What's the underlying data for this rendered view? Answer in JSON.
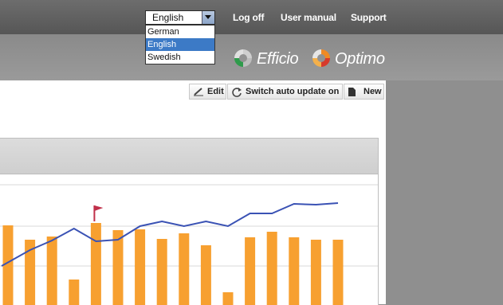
{
  "topnav": {
    "language_selected": "English",
    "logoff": "Log off",
    "manual": "User manual",
    "support": "Support"
  },
  "language_menu": {
    "options": [
      "German",
      "English",
      "Swedish"
    ],
    "highlighted_index": 1
  },
  "brand": {
    "product1": "Efficio",
    "product2": "Optimo",
    "colors": {
      "green": "#2e9b4b",
      "orange": "#f08a24",
      "red": "#d63a2b"
    }
  },
  "toolbar": {
    "edit": "Edit",
    "auto_update": "Switch auto update on",
    "new": "New"
  },
  "chart_data": {
    "type": "bar",
    "values": [
      100,
      82,
      86,
      32,
      103,
      94,
      95,
      83,
      90,
      75,
      16,
      85,
      92,
      85,
      82,
      82
    ],
    "line_values": [
      49,
      69,
      81,
      96,
      80,
      82,
      99,
      105,
      99,
      105,
      99,
      115,
      115,
      127,
      126,
      128
    ],
    "flag_index": 4,
    "colors": {
      "bar": "#f7a030",
      "line": "#3a52b4",
      "flag": "#c0304a",
      "grid": "#d8d8d8"
    }
  }
}
